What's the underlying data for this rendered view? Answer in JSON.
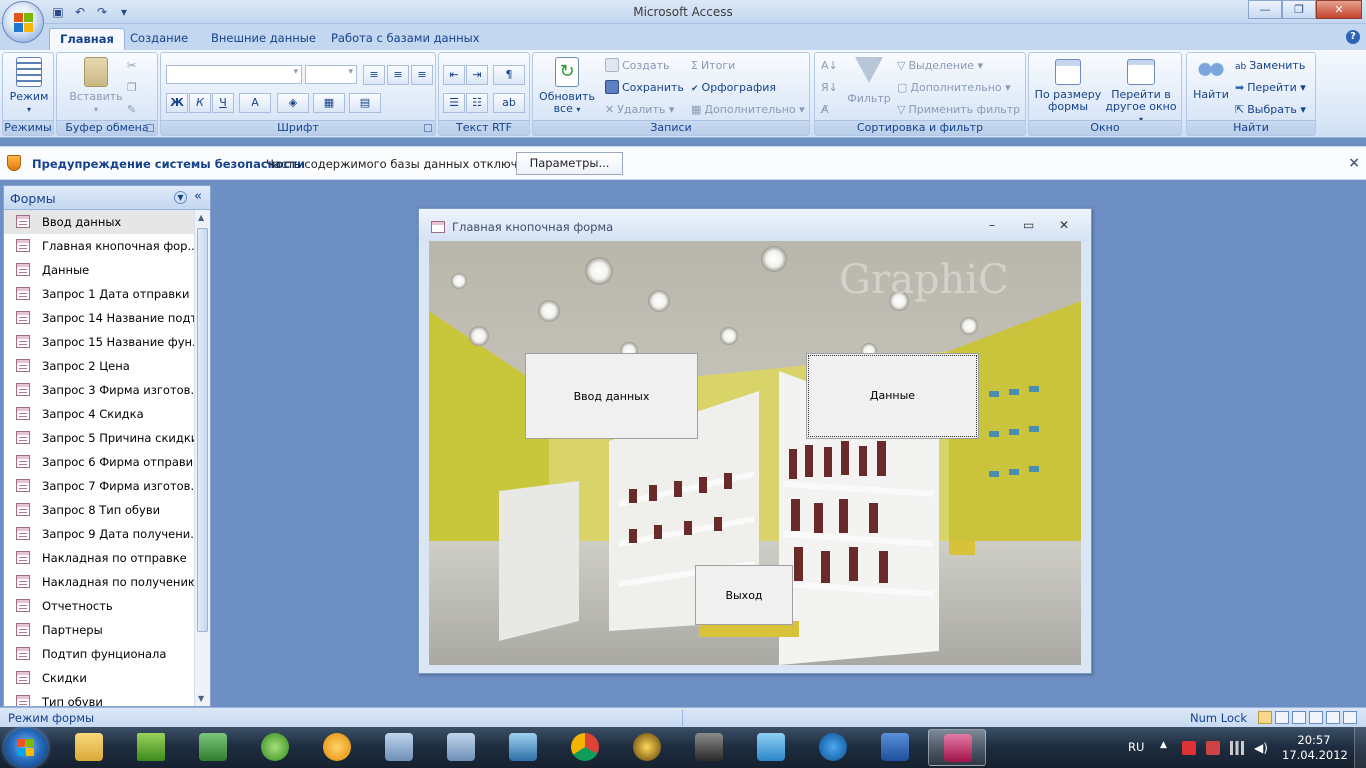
{
  "app": {
    "title": "Microsoft Access",
    "colors": {
      "ribbon_text": "#15428b",
      "workspace": "#6d8fc4",
      "accent": "#2e62b4"
    }
  },
  "tabs": [
    {
      "label": "Главная",
      "active": true
    },
    {
      "label": "Создание"
    },
    {
      "label": "Внешние данные"
    },
    {
      "label": "Работа с базами данных"
    }
  ],
  "ribbon": {
    "groups": {
      "modes": "Режимы",
      "clipboard": "Буфер обмена",
      "font": "Шрифт",
      "rtf": "Текст RTF",
      "records": "Записи",
      "sort_filter": "Сортировка и фильтр",
      "window": "Окно",
      "find": "Найти"
    },
    "mode_btn": "Режим",
    "paste_btn": "Вставить",
    "refresh_btn": "Обновить все",
    "records": {
      "create": "Создать",
      "save": "Сохранить",
      "delete": "Удалить",
      "totals": "Итоги",
      "spelling": "Орфография",
      "more": "Дополнительно"
    },
    "filter_btn": "Фильтр",
    "sort_filter": {
      "selection": "Выделение",
      "advanced": "Дополнительно",
      "apply": "Применить фильтр"
    },
    "window": {
      "fit": "По размеру формы",
      "switch": "Перейти в другое окно"
    },
    "find": {
      "find_btn": "Найти",
      "replace": "Заменить",
      "goto": "Перейти",
      "select": "Выбрать"
    },
    "format": {
      "bold": "Ж",
      "italic": "К",
      "underline": "Ч",
      "font_color": "A"
    }
  },
  "security": {
    "title": "Предупреждение системы безопасности",
    "message": "Часть содержимого базы данных отключено",
    "button": "Параметры...",
    "close": "×"
  },
  "nav": {
    "header": "Формы",
    "items": [
      {
        "label": "Ввод данных",
        "selected": true
      },
      {
        "label": "Главная кнопочная фор..."
      },
      {
        "label": "Данные"
      },
      {
        "label": "Запрос 1 Дата отправки"
      },
      {
        "label": "Запрос 14 Название подт..."
      },
      {
        "label": "Запрос 15 Название фун..."
      },
      {
        "label": "Запрос 2 Цена"
      },
      {
        "label": "Запрос 3 Фирма изготов..."
      },
      {
        "label": "Запрос 4 Скидка"
      },
      {
        "label": "Запрос 5 Причина скидки"
      },
      {
        "label": "Запрос 6 Фирма отправи..."
      },
      {
        "label": "Запрос 7 Фирма изготов..."
      },
      {
        "label": "Запрос 8 Тип обуви"
      },
      {
        "label": "Запрос 9 Дата получени..."
      },
      {
        "label": "Накладная по отправке"
      },
      {
        "label": "Накладная по получению"
      },
      {
        "label": "Отчетность"
      },
      {
        "label": "Партнеры"
      },
      {
        "label": "Подтип фунционала"
      },
      {
        "label": "Скидки"
      },
      {
        "label": "Тип обуви"
      }
    ]
  },
  "form": {
    "title": "Главная кнопочная форма",
    "watermark": "GraphiC",
    "buttons": {
      "input": "Ввод данных",
      "data": "Данные",
      "exit": "Выход"
    }
  },
  "status": {
    "left": "Режим формы",
    "numlock": "Num Lock"
  },
  "taskbar": {
    "lang": "RU",
    "time": "20:57",
    "date": "17.04.2012"
  }
}
